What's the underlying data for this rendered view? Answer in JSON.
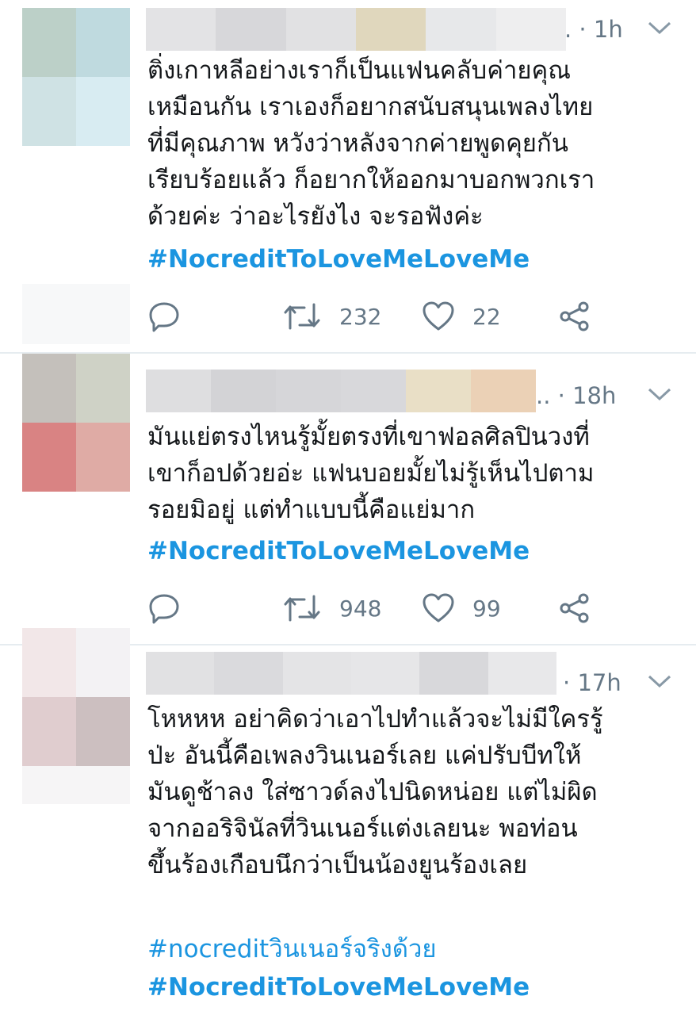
{
  "tweets": [
    {
      "time": "1h",
      "text": "ติ่งเกาหลีอย่างเราก็เป็นแฟนคลับค่ายคุณ\nเหมือนกัน เราเองก็อยากสนับสนุนเพลงไทย\nที่มีคุณภาพ หวังว่าหลังจากค่ายพูดคุยกัน\nเรียบร้อยแล้ว ก็อยากให้ออกมาบอกพวกเรา\nด้วยค่ะ ว่าอะไรยังไง จะรอฟังค่ะ",
      "hashtags": [
        "#NocreditToLoveMeLoveMe"
      ],
      "retweets": "232",
      "likes": "22"
    },
    {
      "time": "18h",
      "text": "มันแย่ตรงไหนรู้มั้ยตรงที่เขาฟอลศิลปินวงที่\nเขาก็อปด้วยอ่ะ แฟนบอยมั้ยไม่รู้เห็นไปตาม\nรอยมิอยู่ แต่ทำแบบนี้คือแย่มาก",
      "hashtags": [
        "#NocreditToLoveMeLoveMe"
      ],
      "retweets": "948",
      "likes": "99"
    },
    {
      "time": "17h",
      "text": "โหหหห อย่าคิดว่าเอาไปทำแล้วจะไม่มีใครรู้\nป่ะ อันนี้คือเพลงวินเนอร์เลย แค่ปรับบีทให้\nมันดูช้าลง ใส่ซาวด์ลงไปนิดหน่อย แต่ไม่ผิด\nจากออริจินัลที่วินเนอร์แต่งเลยนะ พอท่อน\nขึ้นร้องเกือบนึกว่าเป็นน้องยูนร้องเลย",
      "hashtags": [
        "#nocreditวินเนอร์จริงด้วย",
        "#NocreditToLoveMeLoveMe"
      ]
    }
  ],
  "colors": {
    "accent": "#1b95e0",
    "muted": "#657786",
    "divider": "#e6ecf0"
  }
}
